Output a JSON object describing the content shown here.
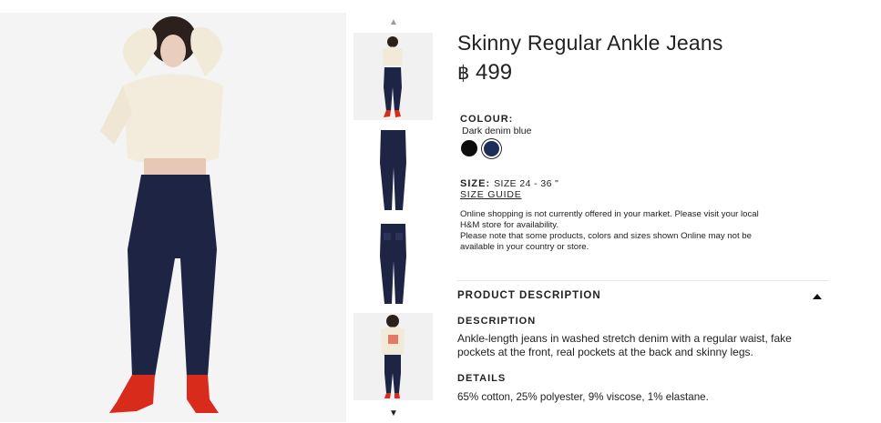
{
  "product": {
    "title": "Skinny Regular Ankle Jeans",
    "currency_symbol": "฿",
    "price": "499",
    "colour_label": "COLOUR:",
    "colour_name": "Dark denim blue",
    "swatches": [
      {
        "name": "Black",
        "color": "#0d0d0d",
        "selected": false
      },
      {
        "name": "Dark denim blue",
        "color": "#1c2d57",
        "selected": true
      }
    ],
    "size_label": "SIZE:",
    "size_value": "SIZE 24 - 36 \"",
    "size_guide": "SIZE GUIDE",
    "notice_line1": "Online shopping is not currently offered in your market. Please visit your local H&M store for availability.",
    "notice_line2": "Please note that some products, colors and sizes shown Online may not be available in your country or store."
  },
  "product_description": {
    "header": "PRODUCT DESCRIPTION",
    "expanded": true,
    "description_label": "DESCRIPTION",
    "description_text": "Ankle-length jeans in washed stretch denim with a regular waist, fake pockets at the front, real pockets at the back and skinny legs.",
    "details_label": "DETAILS",
    "details_text": "65% cotton, 25% polyester, 9% viscose, 1% elastane."
  },
  "gallery": {
    "up_arrow": "chevron-up-icon",
    "down_arrow": "chevron-down-icon",
    "thumbnails": [
      "model-front",
      "jeans-front",
      "jeans-back",
      "model-back"
    ]
  }
}
